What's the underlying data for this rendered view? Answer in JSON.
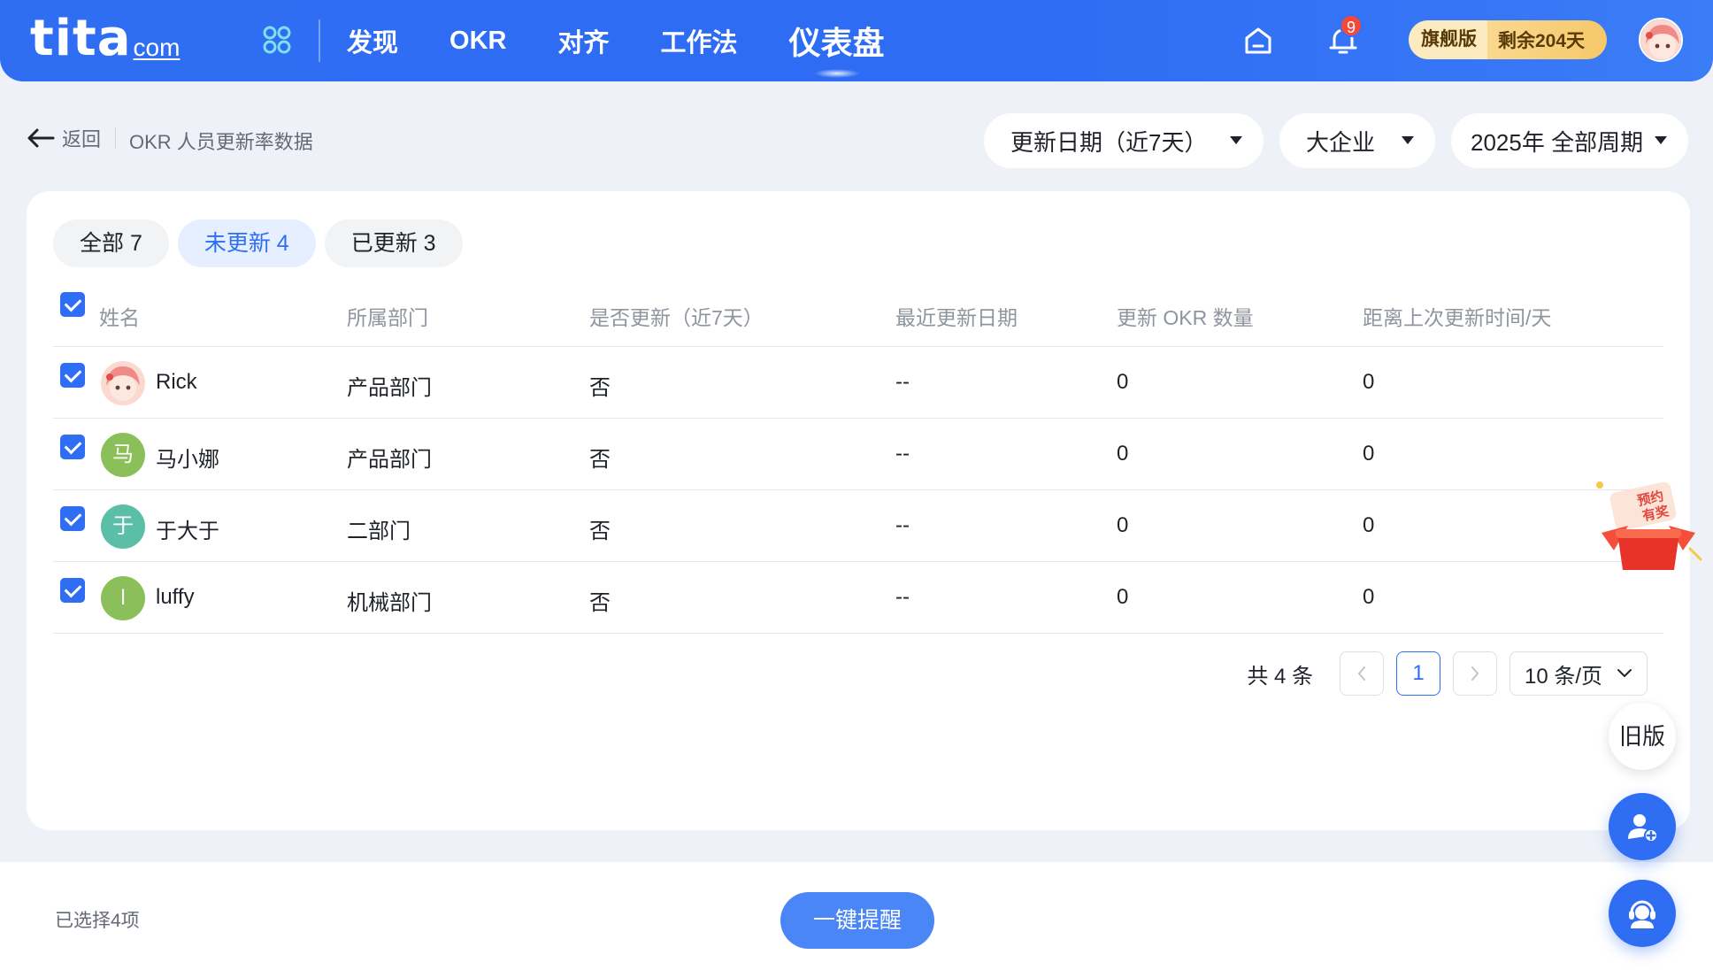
{
  "brand": {
    "logo_main": "tita",
    "logo_suffix": "com"
  },
  "nav": {
    "items": [
      {
        "label": "发现"
      },
      {
        "label": "OKR"
      },
      {
        "label": "对齐"
      },
      {
        "label": "工作法"
      },
      {
        "label": "仪表盘"
      }
    ],
    "active": "仪表盘",
    "notification_count": "9",
    "plan_label": "旗舰版",
    "plan_remaining": "剩余204天"
  },
  "subheader": {
    "back_label": "返回",
    "title": "OKR 人员更新率数据",
    "filters": [
      {
        "label": "更新日期（近7天）"
      },
      {
        "label": "大企业"
      },
      {
        "label": "2025年 全部周期"
      }
    ]
  },
  "tabs": [
    {
      "label": "全部 7"
    },
    {
      "label": "未更新 4"
    },
    {
      "label": "已更新 3"
    }
  ],
  "table": {
    "columns": [
      "姓名",
      "所属部门",
      "是否更新（近7天）",
      "最近更新日期",
      "更新 OKR 数量",
      "距离上次更新时间/天"
    ],
    "rows": [
      {
        "avatar": "",
        "avatar_color": "#f3a6a0",
        "name": "Rick",
        "dept": "产品部门",
        "updated": "否",
        "last_date": "--",
        "okr_count": "0",
        "days": "0"
      },
      {
        "avatar": "马",
        "avatar_color": "#8bbf5a",
        "name": "马小娜",
        "dept": "产品部门",
        "updated": "否",
        "last_date": "--",
        "okr_count": "0",
        "days": "0"
      },
      {
        "avatar": "于",
        "avatar_color": "#5bbfa8",
        "name": "于大于",
        "dept": "二部门",
        "updated": "否",
        "last_date": "--",
        "okr_count": "0",
        "days": "0"
      },
      {
        "avatar": "l",
        "avatar_color": "#8bbf5a",
        "name": "luffy",
        "dept": "机械部门",
        "updated": "否",
        "last_date": "--",
        "okr_count": "0",
        "days": "0"
      }
    ]
  },
  "pager": {
    "total": "共 4 条",
    "current_page": "1",
    "page_size": "10 条/页"
  },
  "footer": {
    "selected": "已选择4项",
    "remind_button": "一键提醒"
  },
  "floating": {
    "promo_line1": "预约",
    "promo_line2": "有奖",
    "old_version": "旧版"
  },
  "colors": {
    "primary": "#2f6df3",
    "nav_bg": "#2f6df3",
    "plan_gold": "#f6c869",
    "badge_red": "#f5483b"
  }
}
